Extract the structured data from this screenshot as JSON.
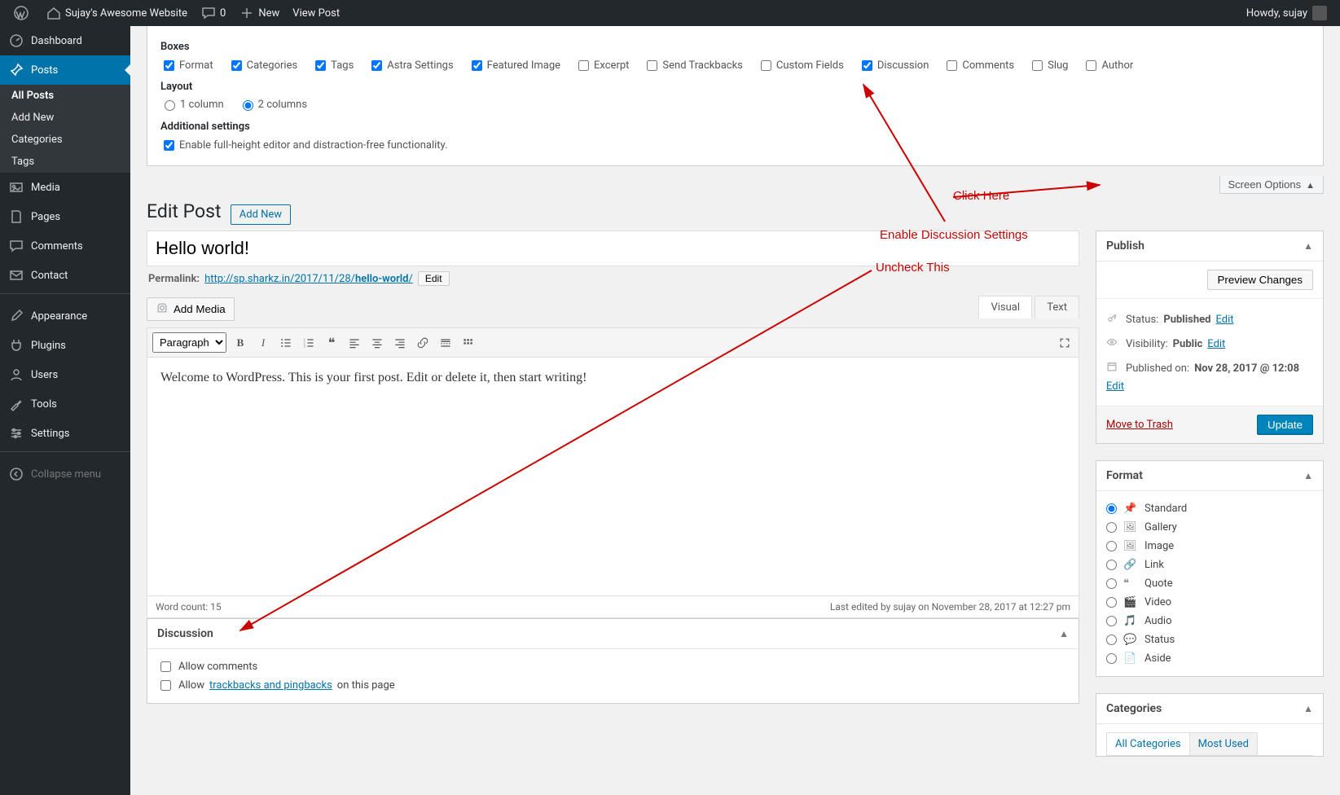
{
  "adminbar": {
    "site_name": "Sujay's Awesome Website",
    "comments_count": "0",
    "new_label": "New",
    "view_post_label": "View Post",
    "howdy": "Howdy, sujay"
  },
  "sidebar": {
    "items": [
      {
        "label": "Dashboard"
      },
      {
        "label": "Posts"
      },
      {
        "label": "Media"
      },
      {
        "label": "Pages"
      },
      {
        "label": "Comments"
      },
      {
        "label": "Contact"
      },
      {
        "label": "Appearance"
      },
      {
        "label": "Plugins"
      },
      {
        "label": "Users"
      },
      {
        "label": "Tools"
      },
      {
        "label": "Settings"
      },
      {
        "label": "Collapse menu"
      }
    ],
    "posts_submenu": [
      "All Posts",
      "Add New",
      "Categories",
      "Tags"
    ]
  },
  "screen_options": {
    "boxes_heading": "Boxes",
    "boxes": [
      {
        "label": "Format",
        "checked": true
      },
      {
        "label": "Categories",
        "checked": true
      },
      {
        "label": "Tags",
        "checked": true
      },
      {
        "label": "Astra Settings",
        "checked": true
      },
      {
        "label": "Featured Image",
        "checked": true
      },
      {
        "label": "Excerpt",
        "checked": false
      },
      {
        "label": "Send Trackbacks",
        "checked": false
      },
      {
        "label": "Custom Fields",
        "checked": false
      },
      {
        "label": "Discussion",
        "checked": true
      },
      {
        "label": "Comments",
        "checked": false
      },
      {
        "label": "Slug",
        "checked": false
      },
      {
        "label": "Author",
        "checked": false
      }
    ],
    "layout_heading": "Layout",
    "layout_options": [
      {
        "label": "1 column",
        "checked": false
      },
      {
        "label": "2 columns",
        "checked": true
      }
    ],
    "additional_heading": "Additional settings",
    "additional_label": "Enable full-height editor and distraction-free functionality.",
    "additional_checked": true,
    "tab_label": "Screen Options"
  },
  "page": {
    "title": "Edit Post",
    "add_new": "Add New"
  },
  "post": {
    "title_value": "Hello world!",
    "permalink_label": "Permalink:",
    "permalink_base": "http://sp.sharkz.in/2017/11/28/",
    "permalink_slug": "hello-world",
    "permalink_trail": "/",
    "edit_slug_btn": "Edit",
    "add_media": "Add Media",
    "tab_visual": "Visual",
    "tab_text": "Text",
    "paragraph_option": "Paragraph",
    "content": "Welcome to WordPress. This is your first post. Edit or delete it, then start writing!",
    "word_count_label": "Word count: 15",
    "last_edited": "Last edited by sujay on November 28, 2017 at 12:27 pm"
  },
  "publish": {
    "heading": "Publish",
    "preview_btn": "Preview Changes",
    "status_label": "Status:",
    "status_value": "Published",
    "visibility_label": "Visibility:",
    "visibility_value": "Public",
    "published_label": "Published on:",
    "published_value": "Nov 28, 2017 @ 12:08",
    "edit_link": "Edit",
    "trash_link": "Move to Trash",
    "update_btn": "Update"
  },
  "format": {
    "heading": "Format",
    "options": [
      "Standard",
      "Gallery",
      "Image",
      "Link",
      "Quote",
      "Video",
      "Audio",
      "Status",
      "Aside"
    ],
    "selected": "Standard"
  },
  "categories": {
    "heading": "Categories",
    "tab_all": "All Categories",
    "tab_most_used": "Most Used"
  },
  "discussion": {
    "heading": "Discussion",
    "allow_comments": "Allow comments",
    "allow_pingbacks_prefix": "Allow ",
    "allow_pingbacks_link": "trackbacks and pingbacks",
    "allow_pingbacks_suffix": " on this page"
  },
  "annotations": {
    "click_here": "Click Here",
    "enable_discussion": "Enable Discussion Settings",
    "uncheck_this": "Uncheck This"
  }
}
